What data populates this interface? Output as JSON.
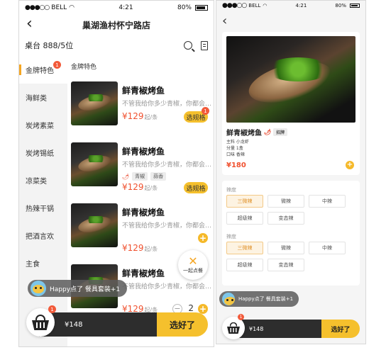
{
  "status": {
    "carrier": "BELL",
    "signal": "●●●○○",
    "time": "4:21",
    "battery": "80%"
  },
  "restaurant": {
    "name": "巢湖渔村怀宁路店",
    "table": "桌台 888/5位"
  },
  "categories": [
    {
      "label": "金牌特色",
      "badge": "1"
    },
    {
      "label": "海鲜类"
    },
    {
      "label": "炭烤素菜"
    },
    {
      "label": "炭烤锡纸"
    },
    {
      "label": "凉菜类"
    },
    {
      "label": "热辣干锅"
    },
    {
      "label": "把酒言欢"
    },
    {
      "label": "主食"
    }
  ],
  "section_title": "金牌特色",
  "dishes": [
    {
      "name": "鲜青椒烤鱼",
      "desc": "不管我给你多少青椒，你都会…",
      "price": "¥129",
      "unit": "起/条",
      "action": "选规格",
      "badge": "1"
    },
    {
      "name": "鲜青椒烤鱼",
      "desc": "不管我给你多少青椒，你都会…",
      "tags": [
        "青椒",
        "蒜香"
      ],
      "price": "¥129",
      "unit": "起/条",
      "action": "选规格"
    },
    {
      "name": "鲜青椒烤鱼",
      "desc": "不管我给你多少青椒，你都会…",
      "price": "¥129",
      "unit": "起/条",
      "add": "+"
    },
    {
      "name": "鲜青椒烤鱼",
      "desc": "不管我给你多少青椒，你都会…",
      "price": "¥129",
      "unit": "起/条",
      "qty": "2",
      "minus": "−",
      "add": "+"
    }
  ],
  "group_order": {
    "icon": "✕",
    "label": "一起点餐"
  },
  "toast": {
    "text": "Happy点了 餐具套装+1"
  },
  "cart": {
    "badge": "1",
    "total": "¥148",
    "checkout": "选好了"
  },
  "detail": {
    "name": "鲜青椒烤鱼",
    "tag": "招牌",
    "attrs": [
      "主料  小龙虾",
      "分量  1盒",
      "口味  香辣"
    ],
    "price": "¥180",
    "add": "+",
    "group1": {
      "title": "辣度",
      "options": [
        "三微辣",
        "微辣",
        "中辣",
        "超级辣",
        "变态辣"
      ],
      "selected": 0
    },
    "group2": {
      "title": "辣度",
      "options": [
        "三微辣",
        "微辣",
        "中辣",
        "超级辣",
        "变态辣"
      ],
      "selected": 0
    },
    "toast": "Happy点了 餐具套装+1",
    "cart_badge": "1",
    "total": "¥148",
    "checkout": "选好了"
  }
}
